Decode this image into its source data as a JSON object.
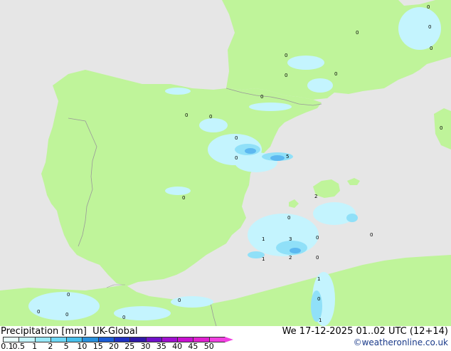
{
  "header": {
    "title": "Precipitation [mm]  UK-Global",
    "timestamp": "We 17-12-2025 01..02 UTC (12+14)",
    "credit": "©weatheronline.co.uk"
  },
  "legend": {
    "ticks": [
      "0.1",
      "0.5",
      "1",
      "2",
      "5",
      "10",
      "15",
      "20",
      "25",
      "30",
      "35",
      "40",
      "45",
      "50"
    ],
    "colors": [
      "#e8fefe",
      "#c4f4fe",
      "#98e8f8",
      "#6cd6f4",
      "#48c0ec",
      "#2890dc",
      "#1c5cd4",
      "#2030c0",
      "#3018a8",
      "#7010c8",
      "#a010d0",
      "#c810d0",
      "#e020d0",
      "#f040e0"
    ]
  },
  "map": {
    "colors": {
      "sea": "#e6e6e6",
      "land": "#bff49a",
      "border": "#999999",
      "rain_light": "#c4f4fe",
      "rain_medium": "#90e0f8",
      "rain_heavy": "#5cb8f0"
    },
    "labels": [
      "0",
      "0",
      "0",
      "0",
      "0",
      "0",
      "0",
      "0",
      "0",
      "0",
      "0",
      "5",
      "0",
      "2",
      "0",
      "1",
      "3",
      "0",
      "1",
      "2",
      "0",
      "0",
      "0",
      "0",
      "1",
      "0",
      "0",
      "0",
      "0",
      "0",
      "0",
      "1"
    ]
  }
}
